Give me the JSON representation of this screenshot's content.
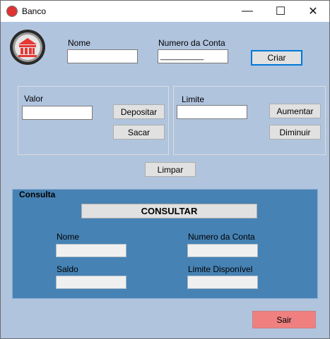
{
  "window": {
    "title": "Banco"
  },
  "titlebar": {
    "minimize": "—",
    "maximize": "☐",
    "close": "✕"
  },
  "account": {
    "nome_label": "Nome",
    "numero_label": "Numero da Conta",
    "numero_value": "__________",
    "criar_button": "Criar"
  },
  "valor_group": {
    "label": "Valor",
    "depositar_button": "Depositar",
    "sacar_button": "Sacar"
  },
  "limite_group": {
    "label": "Limite",
    "aumentar_button": "Aumentar",
    "diminuir_button": "Diminuir"
  },
  "limpar_button": "Limpar",
  "consulta": {
    "title": "Consulta",
    "consultar_button": "CONSULTAR",
    "nome_label": "Nome",
    "numero_label": "Numero da Conta",
    "saldo_label": "Saldo",
    "limite_label": "Limite Disponível"
  },
  "sair_button": "Sair",
  "colors": {
    "background": "#b0c4de",
    "consulta_panel": "#4682b4",
    "sair": "#f08080",
    "accent": "#0078d7"
  }
}
